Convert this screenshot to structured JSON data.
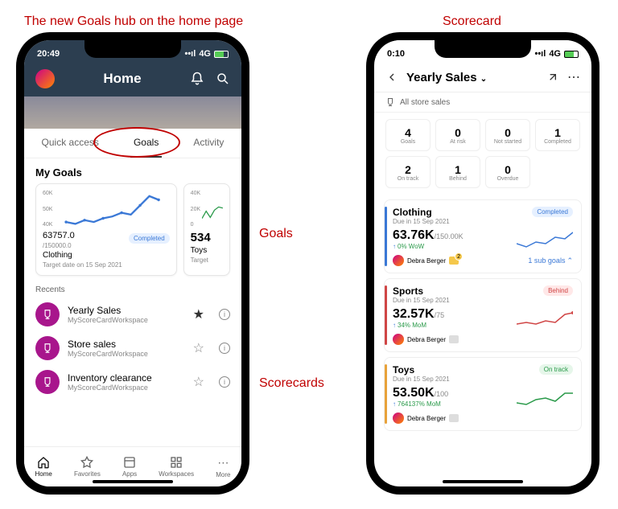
{
  "captions": {
    "top_left": "The new Goals hub on the home page",
    "top_right": "Scorecard",
    "goals": "Goals",
    "scorecards": "Scorecards"
  },
  "left_phone": {
    "status_time": "20:49",
    "status_net": "4G",
    "header": {
      "title": "Home"
    },
    "tabs": {
      "quick_access": "Quick access",
      "goals": "Goals",
      "activity": "Activity"
    },
    "section_my_goals": "My Goals",
    "goal1": {
      "axis_top": "60K",
      "axis_mid": "50K",
      "axis_bot": "40K",
      "value": "63757.0",
      "target": "/150000.0",
      "status": "Completed",
      "name": "Clothing",
      "date": "Target date on 15 Sep 2021"
    },
    "goal2": {
      "axis_top": "40K",
      "axis_mid": "20K",
      "axis_bot": "0",
      "value": "534",
      "name": "Toys",
      "date": "Target"
    },
    "recents_label": "Recents",
    "recents": [
      {
        "title": "Yearly Sales",
        "sub": "MyScoreCardWorkspace",
        "fav": "★"
      },
      {
        "title": "Store sales",
        "sub": "MyScoreCardWorkspace",
        "fav": "☆"
      },
      {
        "title": "Inventory clearance",
        "sub": "MyScoreCardWorkspace",
        "fav": "☆"
      }
    ],
    "nav": {
      "home": "Home",
      "favorites": "Favorites",
      "apps": "Apps",
      "workspaces": "Workspaces",
      "more": "More"
    }
  },
  "right_phone": {
    "status_time": "0:10",
    "status_net": "4G",
    "header": {
      "title": "Yearly Sales"
    },
    "breadcrumb": "All store sales",
    "stats": [
      {
        "n": "4",
        "l": "Goals"
      },
      {
        "n": "0",
        "l": "At risk"
      },
      {
        "n": "0",
        "l": "Not started"
      },
      {
        "n": "1",
        "l": "Completed"
      },
      {
        "n": "2",
        "l": "On track"
      },
      {
        "n": "1",
        "l": "Behind"
      },
      {
        "n": "0",
        "l": "Overdue"
      }
    ],
    "goals": [
      {
        "name": "Clothing",
        "due": "Due in 15 Sep 2021",
        "val": "63.76K",
        "of": "/150.00K",
        "delta": "0% WoW",
        "status": "Completed",
        "owner": "Debra Berger",
        "notes": "2",
        "sub": "1 sub goals",
        "color": "blue"
      },
      {
        "name": "Sports",
        "due": "Due in 15 Sep 2021",
        "val": "32.57K",
        "of": "/75",
        "delta": "34% MoM",
        "status": "Behind",
        "owner": "Debra Berger",
        "color": "red"
      },
      {
        "name": "Toys",
        "due": "Due in 15 Sep 2021",
        "val": "53.50K",
        "of": "/100",
        "delta": "764137% MoM",
        "status": "On track",
        "owner": "Debra Berger",
        "color": "orange"
      }
    ]
  },
  "chart_data": [
    {
      "type": "line",
      "title": "Clothing goal sparkline",
      "ylim": [
        40000,
        60000
      ],
      "y_ticks": [
        "40K",
        "50K",
        "60K"
      ],
      "x": [
        1,
        2,
        3,
        4,
        5,
        6,
        7,
        8,
        9,
        10,
        11
      ],
      "values": [
        42000,
        40000,
        43000,
        41000,
        44000,
        45000,
        48000,
        47000,
        53000,
        58000,
        56000
      ]
    },
    {
      "type": "line",
      "title": "Toys goal sparkline (partial)",
      "ylim": [
        0,
        40000
      ],
      "y_ticks": [
        "0",
        "20K",
        "40K"
      ],
      "x": [
        1,
        2,
        3,
        4,
        5,
        6
      ],
      "values": [
        2000,
        15000,
        4000,
        14000,
        20000,
        18000
      ]
    },
    {
      "type": "line",
      "title": "Clothing scorecard sparkline",
      "x": [
        1,
        2,
        3,
        4,
        5,
        6,
        7
      ],
      "values": [
        3,
        1,
        4,
        3,
        6,
        5,
        8
      ]
    },
    {
      "type": "line",
      "title": "Sports scorecard sparkline",
      "x": [
        1,
        2,
        3,
        4,
        5,
        6,
        7
      ],
      "values": [
        2,
        3,
        2,
        4,
        3,
        6,
        7
      ]
    },
    {
      "type": "line",
      "title": "Toys scorecard sparkline",
      "x": [
        1,
        2,
        3,
        4,
        5,
        6,
        7
      ],
      "values": [
        2,
        1,
        3,
        4,
        2,
        6,
        6
      ]
    }
  ]
}
